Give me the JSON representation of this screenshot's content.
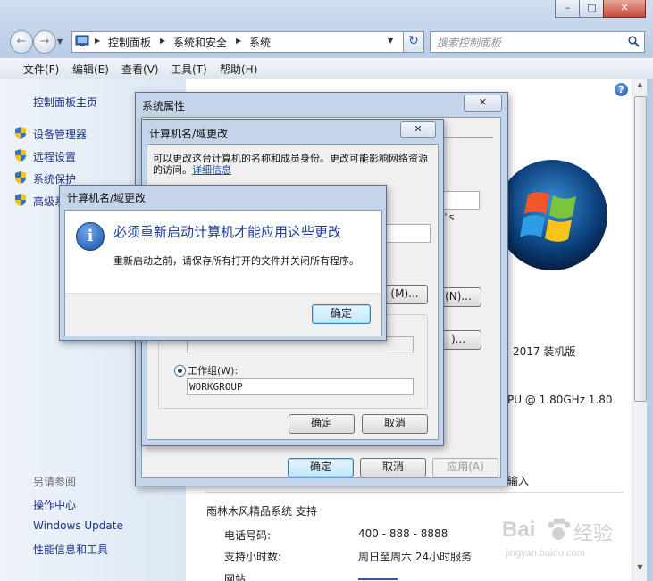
{
  "window": {
    "caption_buttons": [
      "–",
      "□",
      "✕"
    ]
  },
  "nav": {
    "back_icon": "←",
    "forward_icon": "→",
    "breadcrumb": [
      "控制面板",
      "系统和安全",
      "系统"
    ],
    "refresh_icon": "↻",
    "search_placeholder": "搜索控制面板"
  },
  "menu": [
    "文件(F)",
    "编辑(E)",
    "查看(V)",
    "工具(T)",
    "帮助(H)"
  ],
  "sidebar": {
    "home": "控制面板主页",
    "items": [
      "设备管理器",
      "远程设置",
      "系统保护",
      "高级系"
    ],
    "see_also_label": "另请参阅",
    "see_also": [
      "操作中心",
      "Windows Update",
      "性能信息和工具"
    ]
  },
  "content": {
    "edition_suffix": "2017 装机版",
    "cpu_suffix": "PU @ 1.80GHz   1.80",
    "input_fragment": "输入",
    "apostrophe_fragment": "y's",
    "support_title": "雨林木风精品系统 支持",
    "support": [
      {
        "label": "电话号码:",
        "value": "400 - 888 - 8888"
      },
      {
        "label": "支持小时数:",
        "value": "周日至周六  24小时服务"
      }
    ],
    "cut_row": "网站"
  },
  "sysprops": {
    "title": "系统属性",
    "ok": "确定",
    "cancel": "取消",
    "apply": "应用(A)"
  },
  "rename": {
    "title": "计算机名/域更改",
    "desc": "可以更改这台计算机的名称和成员身份。更改可能影响网络资源的访问。",
    "link": "详细信息",
    "btn1_suffix": "(M)...",
    "btn2_suffix": "(N)...",
    "btn3_suffix": ")...",
    "workgroup_label": "工作组(W):",
    "workgroup_value": "WORKGROUP",
    "ok": "确定",
    "cancel": "取消",
    "close_icon": "✕"
  },
  "alert": {
    "title": "计算机名/域更改",
    "heading": "必须重新启动计算机才能应用这些更改",
    "body": "重新启动之前，请保存所有打开的文件并关闭所有程序。",
    "ok": "确定",
    "icon": "i"
  },
  "watermark": {
    "brand": "Bai",
    "brand2": "经验",
    "url": "jingyan.baidu.com"
  },
  "help_icon": "?"
}
